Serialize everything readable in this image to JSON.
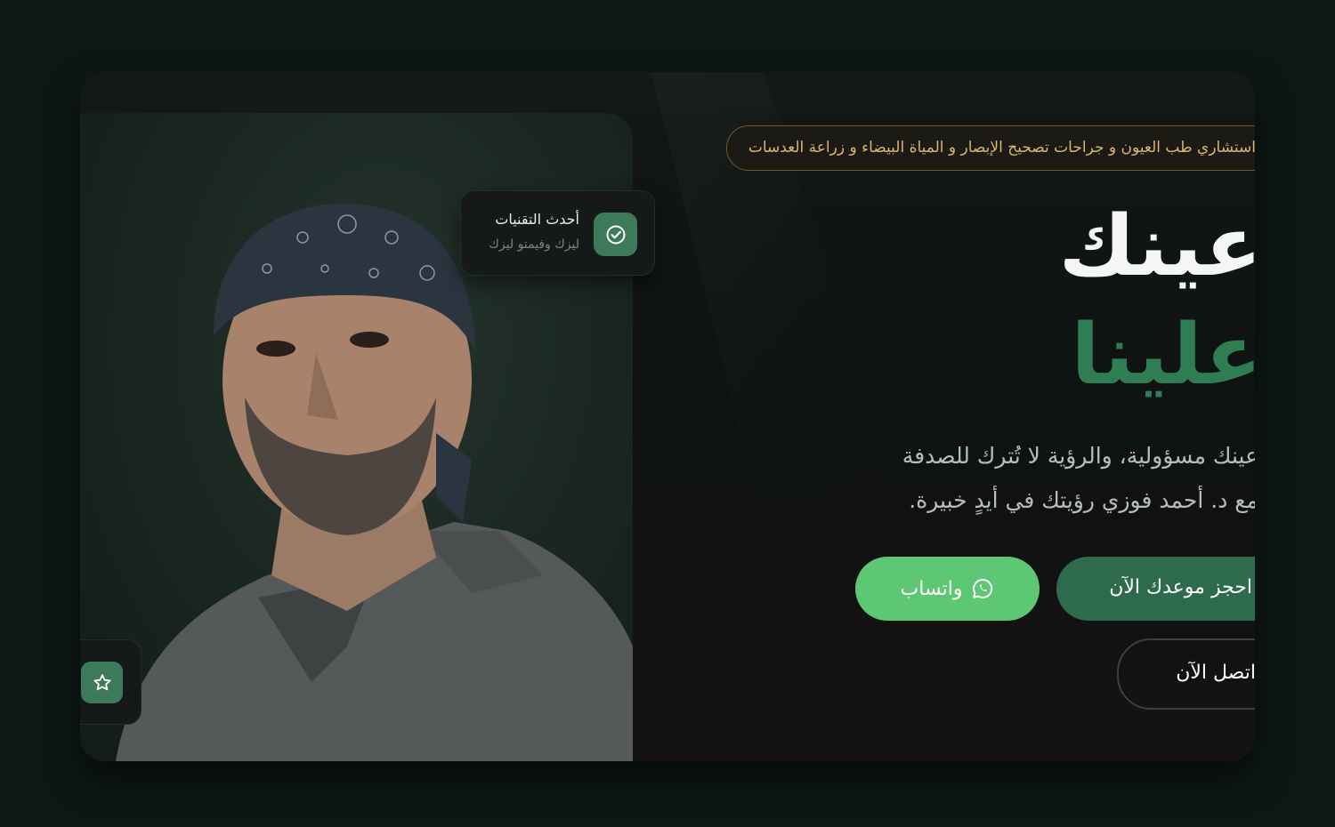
{
  "hero": {
    "tagline": "استشاري طب العيون و جراحات تصحيح الإبصار و المياة البيضاء و زراعة العدسات",
    "heading_line1": "عينك",
    "heading_line2": "علينا",
    "paragraph_line1": "عينك مسؤولية، والرؤية لا تُترك للصدفة",
    "paragraph_line2": "مع د. أحمد فوزي رؤيتك في أيدٍ خبيرة.",
    "whatsapp_label": "واتساب",
    "book_label": "احجز موعدك الآن",
    "call_label": "اتصل الآن"
  },
  "feature_card": {
    "title": "أحدث التقنيات",
    "subtitle": "ليزك وفيمتو ليزك",
    "icon": "check-circle-icon"
  },
  "rating_badge": {
    "icon": "star-icon"
  },
  "colors": {
    "background": "#0d1816",
    "accent_green": "#2f7d52",
    "whatsapp_green": "#5dc774",
    "gold": "#d9b56e"
  }
}
